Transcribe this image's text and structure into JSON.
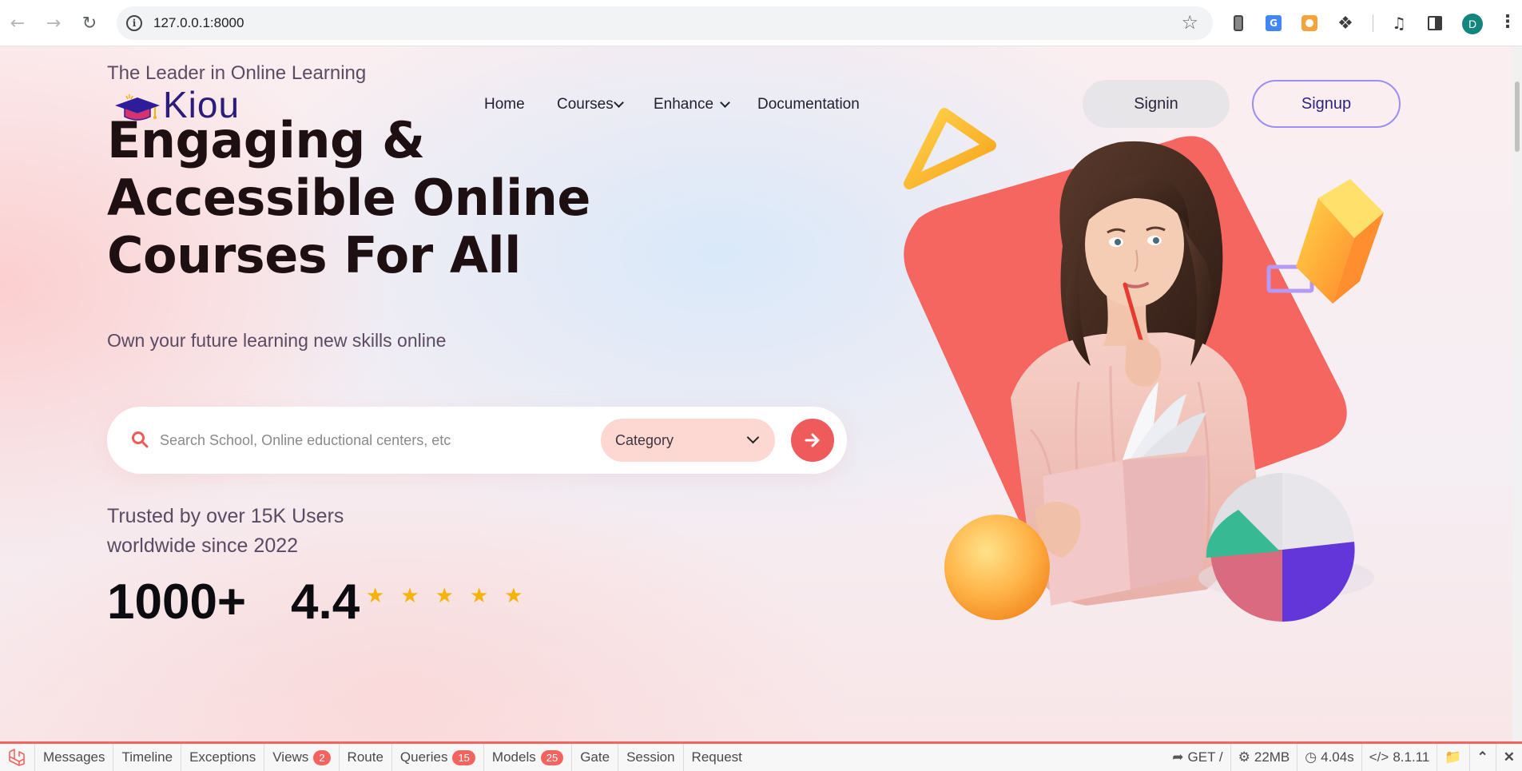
{
  "browser": {
    "url": "127.0.0.1:8000",
    "profile_initial": "D"
  },
  "site": {
    "tagline": "The Leader in Online Learning",
    "logo_text": "Kiou",
    "nav": {
      "home": "Home",
      "courses": "Courses",
      "enhance": "Enhance",
      "documentation": "Documentation"
    },
    "signin_label": "Signin",
    "signup_label": "Signup"
  },
  "hero": {
    "title_line1": "Engaging &",
    "title_line2": "Accessible Online",
    "title_line3": "Courses For All",
    "subtitle": "Own your future learning new skills online"
  },
  "search": {
    "placeholder": "Search School, Online eductional centers, etc",
    "value": "",
    "category_label": "Category"
  },
  "trust": {
    "line1": "Trusted by over 15K Users",
    "line2": "worldwide since 2022",
    "count": "1000+",
    "rating": "4.4",
    "stars": 5
  },
  "debugbar": {
    "tabs": {
      "messages": "Messages",
      "timeline": "Timeline",
      "exceptions": "Exceptions",
      "views": "Views",
      "views_count": "2",
      "route": "Route",
      "queries": "Queries",
      "queries_count": "15",
      "models": "Models",
      "models_count": "25",
      "gate": "Gate",
      "session": "Session",
      "request": "Request"
    },
    "method": "GET /",
    "memory": "22MB",
    "duration": "4.04s",
    "php_version": "8.1.11"
  },
  "colors": {
    "accent": "#ef5a5b",
    "brand": "#2d1d7a",
    "star": "#f5b405",
    "debug_accent": "#f4645f"
  }
}
